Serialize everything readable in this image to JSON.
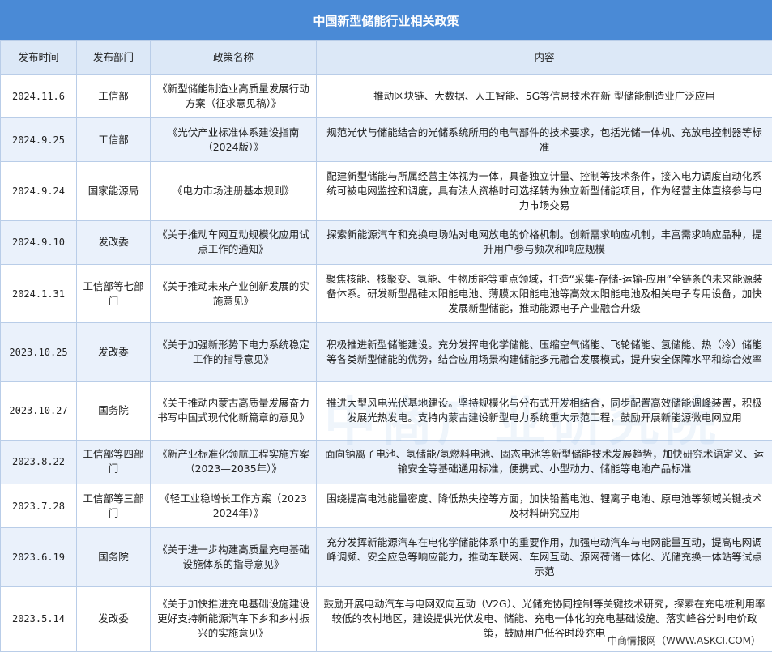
{
  "title": "中国新型储能行业相关政策",
  "headers": [
    "发布时间",
    "发布部门",
    "政策名称",
    "内容"
  ],
  "rows": [
    {
      "date": "2024.11.6",
      "dept": "工信部",
      "name": "《新型储能制造业高质量发展行动方案（征求意见稿）》",
      "content": "推动区块链、大数据、人工智能、5G等信息技术在新 型储能制造业广泛应用"
    },
    {
      "date": "2024.9.25",
      "dept": "工信部",
      "name": "《光伏产业标准体系建设指南（2024版）》",
      "content": "规范光伏与储能结合的光储系统所用的电气部件的技术要求，包括光储一体机、充放电控制器等标准"
    },
    {
      "date": "2024.9.24",
      "dept": "国家能源局",
      "name": "《电力市场注册基本规则》",
      "content": "配建新型储能与所属经营主体视为一体，具备独立计量、控制等技术条件，接入电力调度自动化系统可被电网监控和调度，具有法人资格时可选择转为独立新型储能项目，作为经营主体直接参与电力市场交易"
    },
    {
      "date": "2024.9.10",
      "dept": "发改委",
      "name": "《关于推动车网互动规模化应用试点工作的通知》",
      "content": "探索新能源汽车和充换电场站对电网放电的价格机制。创新需求响应机制，丰富需求响应品种，提升用户参与频次和响应规模"
    },
    {
      "date": "2024.1.31",
      "dept": "工信部等七部门",
      "name": "《关于推动未来产业创新发展的实施意见》",
      "content": "聚焦核能、核聚变、氢能、生物质能等重点领域，打造“采集-存储-运输-应用”全链条的未来能源装备体系。研发新型晶硅太阳能电池、薄膜太阳能电池等高效太阳能电池及相关电子专用设备，加快发展新型储能，推动能源电子产业融合升级"
    },
    {
      "date": "2023.10.25",
      "dept": "发改委",
      "name": "《关于加强新形势下电力系统稳定工作的指导意见》",
      "content": "积极推进新型储能建设。充分发挥电化学储能、压缩空气储能、飞轮储能、氢储能、热（冷）储能等各类新型储能的优势，结合应用场景构建储能多元融合发展模式，提升安全保障水平和综合效率"
    },
    {
      "date": "2023.10.27",
      "dept": "国务院",
      "name": "《关于推动内蒙古高质量发展奋力书写中国式现代化新篇章的意见》",
      "content": "推进大型风电光伏基地建设。坚持规模化与分布式开发相结合，同步配置高效储能调峰装置，积极发展光热发电。支持内蒙古建设新型电力系统重大示范工程，鼓励开展新能源微电网应用"
    },
    {
      "date": "2023.8.22",
      "dept": "工信部等四部门",
      "name": "《新产业标准化领航工程实施方案（2023—2035年）》",
      "content": "面向钠离子电池、氢储能/氢燃料电池、固态电池等新型储能技术发展趋势，加快研究术语定义、运输安全等基础通用标准，便携式、小型动力、储能等电池产品标准"
    },
    {
      "date": "2023.7.28",
      "dept": "工信部等三部门",
      "name": "《轻工业稳增长工作方案（2023—2024年）》",
      "content": "围绕提高电池能量密度、降低热失控等方面，加快铅蓄电池、锂离子电池、原电池等领域关键技术及材料研究应用"
    },
    {
      "date": "2023.6.19",
      "dept": "国务院",
      "name": "《关于进一步构建高质量充电基础设施体系的指导意见》",
      "content": "充分发挥新能源汽车在电化学储能体系中的重要作用，加强电动汽车与电网能量互动，提高电网调峰调频、安全应急等响应能力，推动车联网、车网互动、源网荷储一体化、光储充换一体站等试点示范"
    },
    {
      "date": "2023.5.14",
      "dept": "发改委",
      "name": "《关于加快推进充电基础设施建设更好支持新能源汽车下乡和乡村振兴的实施意见》",
      "content": "鼓励开展电动汽车与电网双向互动（V2G）、光储充协同控制等关键技术研究，探索在充电桩利用率较低的农村地区，建设提供光伏发电、储能、充电一体化的充电基础设施。落实峰谷分时电价政策，鼓励用户低谷时段充电"
    }
  ],
  "footer": "中商情报网（WWW.ASKCI.COM）",
  "watermark": "中商产业研究院",
  "colors": {
    "title_bg": "#4a8ad6",
    "header_bg": "#dce8f7",
    "alt_row_bg": "#eaf1fb",
    "border": "#b9cde8"
  }
}
